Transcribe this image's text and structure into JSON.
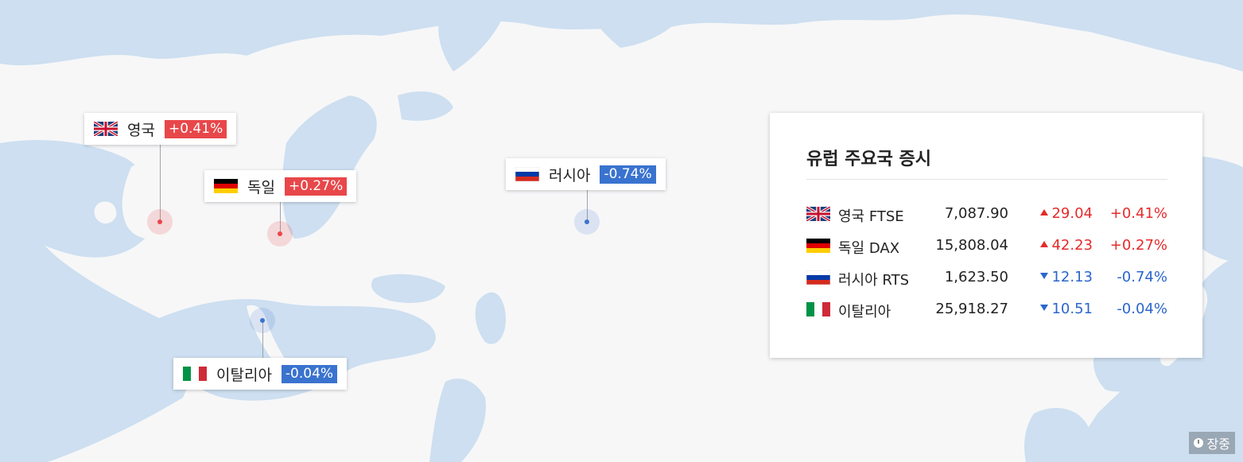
{
  "map_tags": [
    {
      "name": "영국",
      "change": "+0.41%",
      "direction": "up",
      "flag": "uk-flag-icon"
    },
    {
      "name": "독일",
      "change": "+0.27%",
      "direction": "up",
      "flag": "germany-flag-icon"
    },
    {
      "name": "러시아",
      "change": "-0.74%",
      "direction": "down",
      "flag": "russia-flag-icon"
    },
    {
      "name": "이탈리아",
      "change": "-0.04%",
      "direction": "down",
      "flag": "italy-flag-icon"
    }
  ],
  "panel": {
    "title": "유럽 주요국 증시",
    "rows": [
      {
        "name": "영국 FTSE",
        "value": "7,087.90",
        "change": "29.04",
        "percent": "+0.41%",
        "direction": "up",
        "flag": "uk-flag-icon"
      },
      {
        "name": "독일 DAX",
        "value": "15,808.04",
        "change": "42.23",
        "percent": "+0.27%",
        "direction": "up",
        "flag": "germany-flag-icon"
      },
      {
        "name": "러시아 RTS",
        "value": "1,623.50",
        "change": "12.13",
        "percent": "-0.74%",
        "direction": "down",
        "flag": "russia-flag-icon"
      },
      {
        "name": "이탈리아",
        "value": "25,918.27",
        "change": "10.51",
        "percent": "-0.04%",
        "direction": "down",
        "flag": "italy-flag-icon"
      }
    ]
  },
  "status": {
    "label": "장중",
    "icon": "clock-icon"
  },
  "colors": {
    "up": "#e8474a",
    "down": "#3a73cf",
    "sea": "#cddff0",
    "land": "#f7f7f8"
  }
}
